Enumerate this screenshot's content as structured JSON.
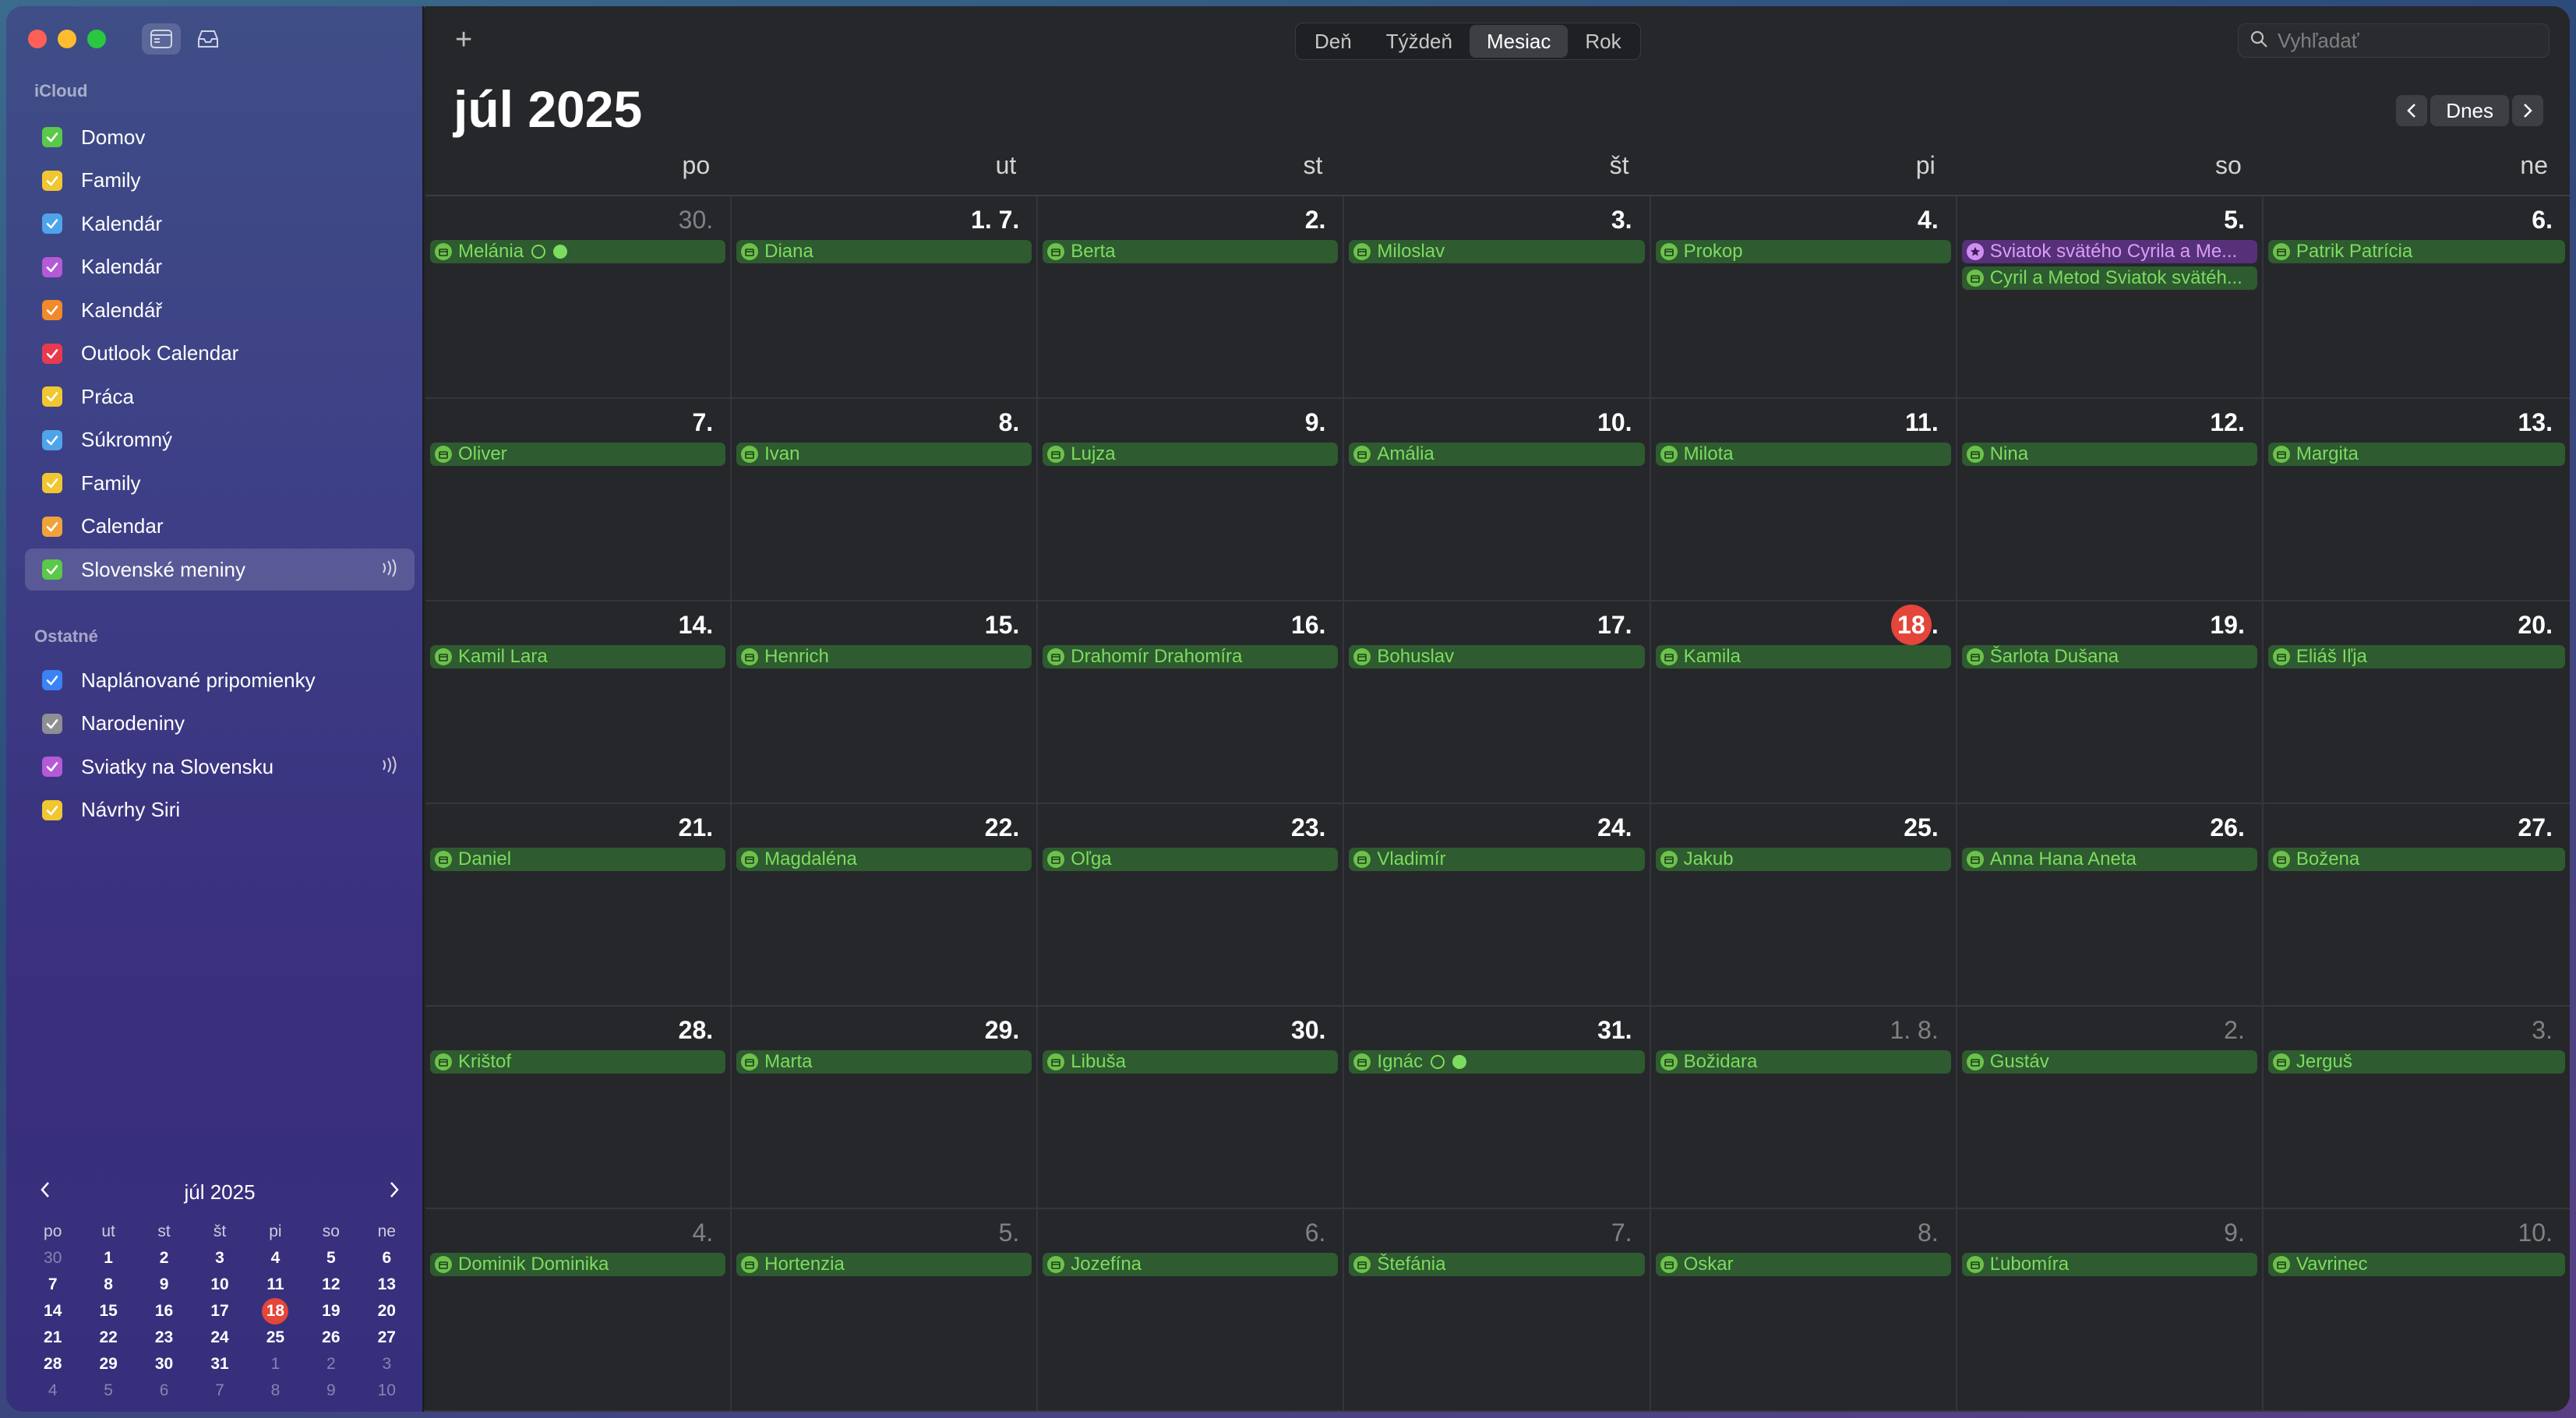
{
  "sidebar": {
    "section_icloud": "iCloud",
    "section_other": "Ostatné",
    "icloud_calendars": [
      {
        "label": "Domov",
        "color": "#5ac84a"
      },
      {
        "label": "Family",
        "color": "#f0c631"
      },
      {
        "label": "Kalendár",
        "color": "#4fa3ea"
      },
      {
        "label": "Kalendár",
        "color": "#b45ad6"
      },
      {
        "label": "Kalendář",
        "color": "#f08a2b"
      },
      {
        "label": "Outlook Calendar",
        "color": "#e83a4e"
      },
      {
        "label": "Práca",
        "color": "#f0c631"
      },
      {
        "label": "Súkromný",
        "color": "#4fa3ea"
      },
      {
        "label": "Family",
        "color": "#f0c631"
      },
      {
        "label": "Calendar",
        "color": "#f0a23a"
      },
      {
        "label": "Slovenské meniny",
        "color": "#5ac84a"
      }
    ],
    "other_calendars": [
      {
        "label": "Naplánované pripomienky",
        "color": "#3b82f6"
      },
      {
        "label": "Narodeniny",
        "color": "#8e8e93"
      },
      {
        "label": "Sviatky na Slovensku",
        "color": "#b45ad6"
      },
      {
        "label": "Návrhy Siri",
        "color": "#f0c631"
      }
    ],
    "mini_calendar": {
      "title": "júl 2025",
      "dow": [
        "po",
        "ut",
        "st",
        "št",
        "pi",
        "so",
        "ne"
      ],
      "weeks": [
        [
          "30",
          "1",
          "2",
          "3",
          "4",
          "5",
          "6"
        ],
        [
          "7",
          "8",
          "9",
          "10",
          "11",
          "12",
          "13"
        ],
        [
          "14",
          "15",
          "16",
          "17",
          "18",
          "19",
          "20"
        ],
        [
          "21",
          "22",
          "23",
          "24",
          "25",
          "26",
          "27"
        ],
        [
          "28",
          "29",
          "30",
          "31",
          "1",
          "2",
          "3"
        ],
        [
          "4",
          "5",
          "6",
          "7",
          "8",
          "9",
          "10"
        ]
      ]
    }
  },
  "toolbar": {
    "views": [
      "Deň",
      "Týždeň",
      "Mesiac",
      "Rok"
    ],
    "active_view": "Mesiac",
    "search_placeholder": "Vyhľadať",
    "today_label": "Dnes"
  },
  "month_title": "júl 2025",
  "weekdays": [
    "po",
    "ut",
    "st",
    "št",
    "pi",
    "so",
    "ne"
  ],
  "weeks": [
    [
      {
        "day": "30.",
        "other": true,
        "events": [
          {
            "title": "Melánia",
            "extras": true
          }
        ]
      },
      {
        "day": "1. 7.",
        "events": [
          {
            "title": "Diana"
          }
        ]
      },
      {
        "day": "2.",
        "events": [
          {
            "title": "Berta"
          }
        ]
      },
      {
        "day": "3.",
        "events": [
          {
            "title": "Miloslav"
          }
        ]
      },
      {
        "day": "4.",
        "events": [
          {
            "title": "Prokop"
          }
        ]
      },
      {
        "day": "5.",
        "events": [
          {
            "title": "Sviatok svätého Cyrila a Me...",
            "holiday": true
          },
          {
            "title": "Cyril a Metod Sviatok svätéh..."
          }
        ]
      },
      {
        "day": "6.",
        "events": [
          {
            "title": "Patrik Patrícia"
          }
        ]
      }
    ],
    [
      {
        "day": "7.",
        "events": [
          {
            "title": "Oliver"
          }
        ]
      },
      {
        "day": "8.",
        "events": [
          {
            "title": "Ivan"
          }
        ]
      },
      {
        "day": "9.",
        "events": [
          {
            "title": "Lujza"
          }
        ]
      },
      {
        "day": "10.",
        "events": [
          {
            "title": "Amália"
          }
        ]
      },
      {
        "day": "11.",
        "events": [
          {
            "title": "Milota"
          }
        ]
      },
      {
        "day": "12.",
        "events": [
          {
            "title": "Nina"
          }
        ]
      },
      {
        "day": "13.",
        "events": [
          {
            "title": "Margita"
          }
        ]
      }
    ],
    [
      {
        "day": "14.",
        "events": [
          {
            "title": "Kamil Lara"
          }
        ]
      },
      {
        "day": "15.",
        "events": [
          {
            "title": "Henrich"
          }
        ]
      },
      {
        "day": "16.",
        "events": [
          {
            "title": "Drahomír Drahomíra"
          }
        ]
      },
      {
        "day": "17.",
        "events": [
          {
            "title": "Bohuslav"
          }
        ]
      },
      {
        "day": "18",
        "today": true,
        "events": [
          {
            "title": "Kamila"
          }
        ]
      },
      {
        "day": "19.",
        "events": [
          {
            "title": "Šarlota Dušana"
          }
        ]
      },
      {
        "day": "20.",
        "events": [
          {
            "title": "Eliáš Iľja"
          }
        ]
      }
    ],
    [
      {
        "day": "21.",
        "events": [
          {
            "title": "Daniel"
          }
        ]
      },
      {
        "day": "22.",
        "events": [
          {
            "title": "Magdaléna"
          }
        ]
      },
      {
        "day": "23.",
        "events": [
          {
            "title": "Oľga"
          }
        ]
      },
      {
        "day": "24.",
        "events": [
          {
            "title": "Vladimír"
          }
        ]
      },
      {
        "day": "25.",
        "events": [
          {
            "title": "Jakub"
          }
        ]
      },
      {
        "day": "26.",
        "events": [
          {
            "title": "Anna Hana Aneta"
          }
        ]
      },
      {
        "day": "27.",
        "events": [
          {
            "title": "Božena"
          }
        ]
      }
    ],
    [
      {
        "day": "28.",
        "events": [
          {
            "title": "Krištof"
          }
        ]
      },
      {
        "day": "29.",
        "events": [
          {
            "title": "Marta"
          }
        ]
      },
      {
        "day": "30.",
        "events": [
          {
            "title": "Libuša"
          }
        ]
      },
      {
        "day": "31.",
        "events": [
          {
            "title": "Ignác",
            "extras": true
          }
        ]
      },
      {
        "day": "1. 8.",
        "other": true,
        "events": [
          {
            "title": "Božidara"
          }
        ]
      },
      {
        "day": "2.",
        "other": true,
        "events": [
          {
            "title": "Gustáv"
          }
        ]
      },
      {
        "day": "3.",
        "other": true,
        "events": [
          {
            "title": "Jerguš"
          }
        ]
      }
    ],
    [
      {
        "day": "4.",
        "other": true,
        "events": [
          {
            "title": "Dominik Dominika"
          }
        ]
      },
      {
        "day": "5.",
        "other": true,
        "events": [
          {
            "title": "Hortenzia"
          }
        ]
      },
      {
        "day": "6.",
        "other": true,
        "events": [
          {
            "title": "Jozefína"
          }
        ]
      },
      {
        "day": "7.",
        "other": true,
        "events": [
          {
            "title": "Štefánia"
          }
        ]
      },
      {
        "day": "8.",
        "other": true,
        "events": [
          {
            "title": "Oskar"
          }
        ]
      },
      {
        "day": "9.",
        "other": true,
        "events": [
          {
            "title": "Ľubomíra"
          }
        ]
      },
      {
        "day": "10.",
        "other": true,
        "events": [
          {
            "title": "Vavrinec"
          }
        ]
      }
    ]
  ]
}
